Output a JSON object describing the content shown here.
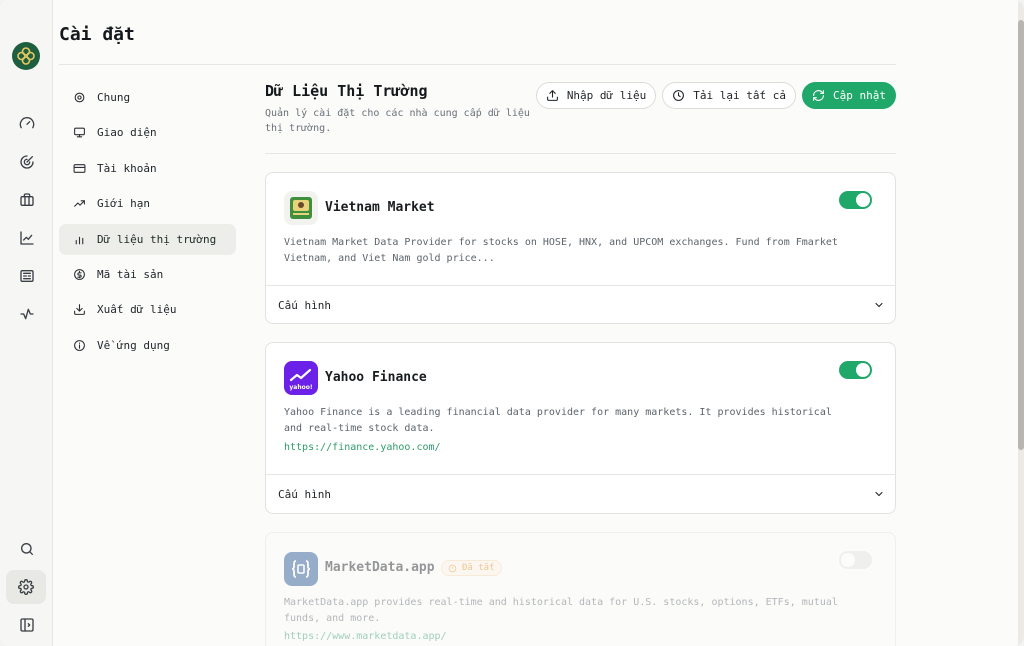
{
  "app": {
    "page_title": "Cài đặt",
    "accent_color": "#1fa86a"
  },
  "rail": {
    "items": [
      {
        "name": "dashboard",
        "icon": "gauge-icon"
      },
      {
        "name": "performance",
        "icon": "target-chart-icon"
      },
      {
        "name": "portfolio",
        "icon": "briefcase-icon"
      },
      {
        "name": "charts",
        "icon": "line-chart-icon"
      },
      {
        "name": "news",
        "icon": "newspaper-icon"
      },
      {
        "name": "activity",
        "icon": "pulse-icon"
      }
    ],
    "bottom": [
      {
        "name": "search",
        "icon": "search-icon"
      },
      {
        "name": "settings",
        "icon": "gear-icon",
        "active": true
      },
      {
        "name": "sidebar",
        "icon": "sidebar-toggle-icon"
      }
    ]
  },
  "nav": {
    "items": [
      {
        "label": "Chung",
        "icon": "gear-icon"
      },
      {
        "label": "Giao diện",
        "icon": "monitor-icon"
      },
      {
        "label": "Tài khoản",
        "icon": "credit-card-icon"
      },
      {
        "label": "Giới hạn",
        "icon": "trending-up-icon"
      },
      {
        "label": "Dữ liệu thị trường",
        "icon": "bar-chart-icon",
        "active": true
      },
      {
        "label": "Mã tài sản",
        "icon": "dollar-circle-icon"
      },
      {
        "label": "Xuất dữ liệu",
        "icon": "download-icon"
      },
      {
        "label": "Về ứng dụng",
        "icon": "info-icon"
      }
    ]
  },
  "section": {
    "title": "Dữ Liệu Thị Trường",
    "description": "Quản lý cài đặt cho các nhà cung cấp dữ liệu thị trường.",
    "actions": {
      "import_label": "Nhập dữ liệu",
      "reload_label": "Tải lại tất cả",
      "update_label": "Cập nhật"
    }
  },
  "providers": [
    {
      "name": "Vietnam Market",
      "description": "Vietnam Market Data Provider for stocks on HOSE, HNX, and UPCOM exchanges. Fund from Fmarket Vietnam, and Viet Nam gold price...",
      "link": "",
      "enabled": true,
      "config_label": "Cấu hình",
      "logo": "vietnam-market-logo"
    },
    {
      "name": "Yahoo Finance",
      "description": "Yahoo Finance is a leading financial data provider for many markets. It provides historical and real-time stock data.",
      "link": "https://finance.yahoo.com/",
      "enabled": true,
      "config_label": "Cấu hình",
      "logo": "yahoo-finance-logo",
      "logo_text": "yahoo!"
    },
    {
      "name": "MarketData.app",
      "description": "MarketData.app provides real-time and historical data for U.S. stocks, options, ETFs, mutual funds, and more.",
      "link": "https://www.marketdata.app/",
      "enabled": false,
      "badge": "Đã tắt",
      "logo": "marketdata-logo"
    }
  ]
}
